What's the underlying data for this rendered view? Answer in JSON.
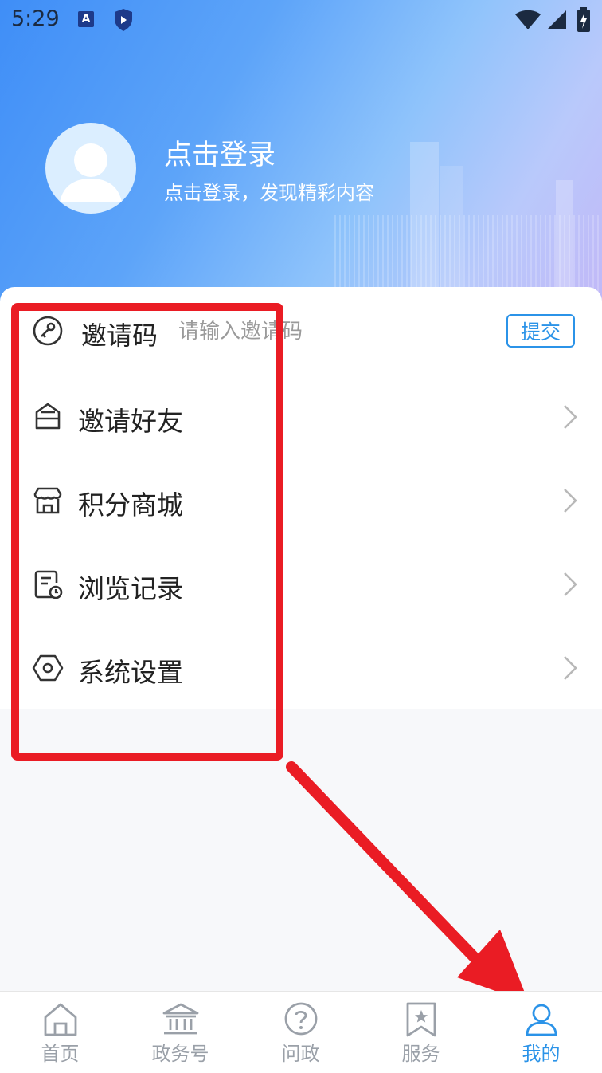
{
  "status_bar": {
    "time": "5:29",
    "icons": [
      "app-a-icon",
      "shield-icon",
      "wifi-icon",
      "signal-icon",
      "battery-charging-icon"
    ]
  },
  "profile": {
    "title": "点击登录",
    "subtitle": "点击登录，发现精彩内容"
  },
  "invite": {
    "label": "邀请码",
    "placeholder": "请输入邀请码",
    "submit_label": "提交"
  },
  "menu": {
    "items": [
      {
        "label": "邀请好友",
        "icon": "envelope-icon"
      },
      {
        "label": "积分商城",
        "icon": "store-icon"
      },
      {
        "label": "浏览记录",
        "icon": "history-icon"
      },
      {
        "label": "系统设置",
        "icon": "settings-icon"
      }
    ]
  },
  "bottom_nav": {
    "items": [
      {
        "label": "首页",
        "icon": "home-icon"
      },
      {
        "label": "政务号",
        "icon": "government-icon"
      },
      {
        "label": "问政",
        "icon": "question-icon"
      },
      {
        "label": "服务",
        "icon": "bookmark-star-icon"
      },
      {
        "label": "我的",
        "icon": "user-icon"
      }
    ],
    "active_index": 4
  },
  "colors": {
    "accent": "#2b93e8",
    "annotation": "#ea1c24",
    "header_gradient_start": "#3f8ef7",
    "header_gradient_end": "#c2b6f7"
  }
}
